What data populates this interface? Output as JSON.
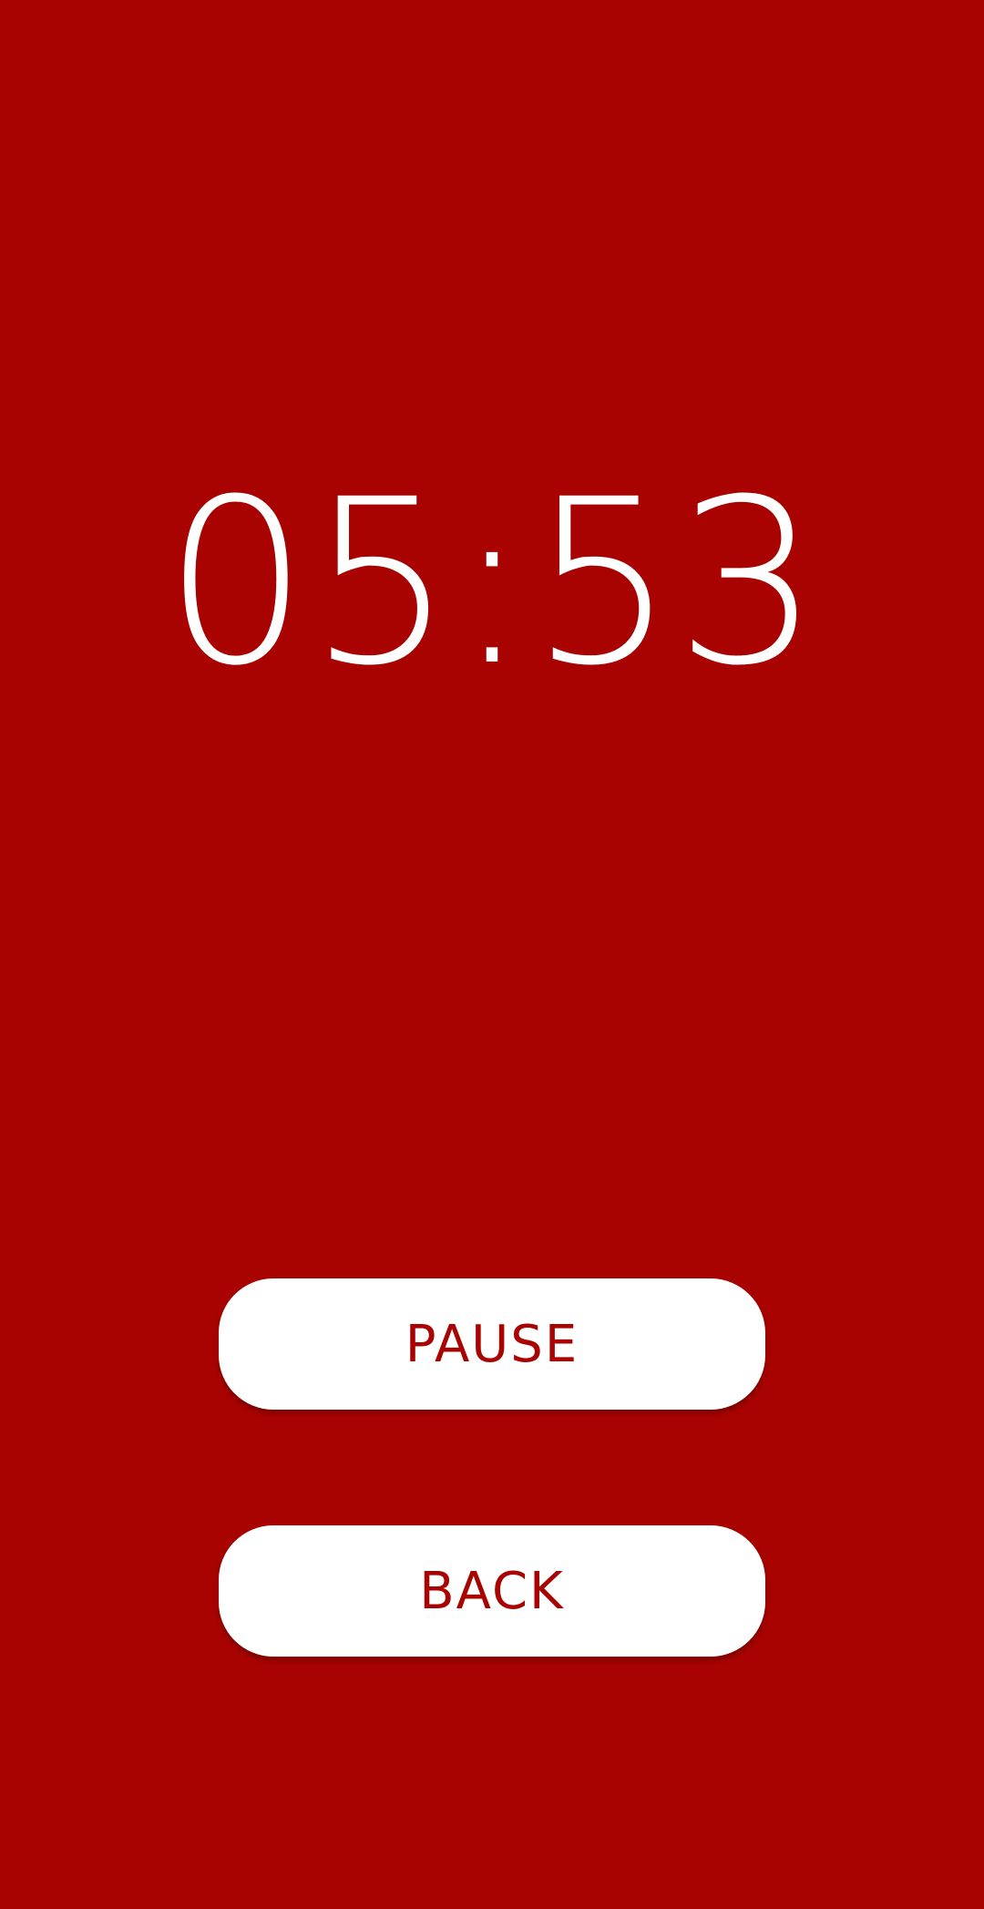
{
  "timer": {
    "display": "05:53"
  },
  "buttons": {
    "pause_label": "PAUSE",
    "back_label": "BACK"
  },
  "colors": {
    "background": "#a80300",
    "button_background": "#ffffff",
    "button_text": "#a80300",
    "timer_text": "#ffffff"
  }
}
